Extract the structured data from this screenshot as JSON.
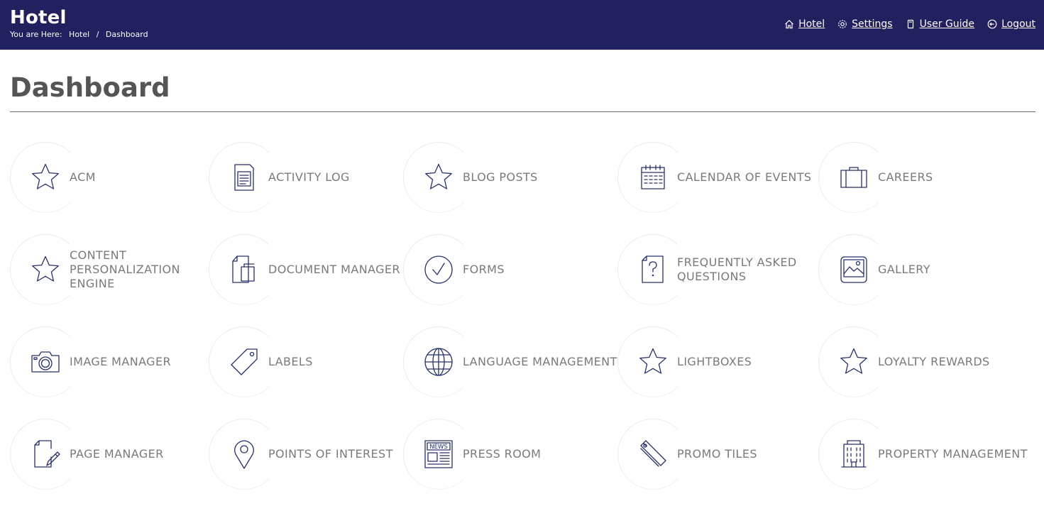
{
  "header": {
    "app_title": "Hotel",
    "breadcrumb_prefix": "You are Here:",
    "breadcrumb": [
      "Hotel",
      "Dashboard"
    ],
    "breadcrumb_separator": "/",
    "nav": [
      {
        "label": "Hotel",
        "icon": "home-icon"
      },
      {
        "label": "Settings",
        "icon": "gear-icon"
      },
      {
        "label": "User Guide",
        "icon": "book-icon"
      },
      {
        "label": "Logout",
        "icon": "logout-icon"
      }
    ]
  },
  "colors": {
    "header_bg": "#232060",
    "icon_stroke": "#26306a"
  },
  "page": {
    "title": "Dashboard"
  },
  "tiles": [
    {
      "label": "ACM",
      "icon": "star-icon"
    },
    {
      "label": "ACTIVITY LOG",
      "icon": "document-icon"
    },
    {
      "label": "BLOG POSTS",
      "icon": "star-icon"
    },
    {
      "label": "CALENDAR OF EVENTS",
      "icon": "calendar-icon"
    },
    {
      "label": "CAREERS",
      "icon": "briefcase-icon"
    },
    {
      "label": "CONTENT PERSONALIZATION ENGINE",
      "icon": "star-icon"
    },
    {
      "label": "DOCUMENT MANAGER",
      "icon": "copy-icon"
    },
    {
      "label": "FORMS",
      "icon": "check-circle-icon"
    },
    {
      "label": "FREQUENTLY ASKED QUESTIONS",
      "icon": "question-document-icon"
    },
    {
      "label": "GALLERY",
      "icon": "gallery-icon"
    },
    {
      "label": "IMAGE MANAGER",
      "icon": "camera-icon"
    },
    {
      "label": "LABELS",
      "icon": "tag-icon"
    },
    {
      "label": "LANGUAGE MANAGEMENT",
      "icon": "globe-icon"
    },
    {
      "label": "LIGHTBOXES",
      "icon": "star-icon"
    },
    {
      "label": "LOYALTY REWARDS",
      "icon": "star-icon"
    },
    {
      "label": "PAGE MANAGER",
      "icon": "page-edit-icon"
    },
    {
      "label": "POINTS OF INTEREST",
      "icon": "map-pin-icon"
    },
    {
      "label": "PRESS ROOM",
      "icon": "newspaper-icon",
      "icon_text": "NEWS"
    },
    {
      "label": "PROMO TILES",
      "icon": "tickets-icon"
    },
    {
      "label": "PROPERTY MANAGEMENT",
      "icon": "building-icon"
    }
  ]
}
